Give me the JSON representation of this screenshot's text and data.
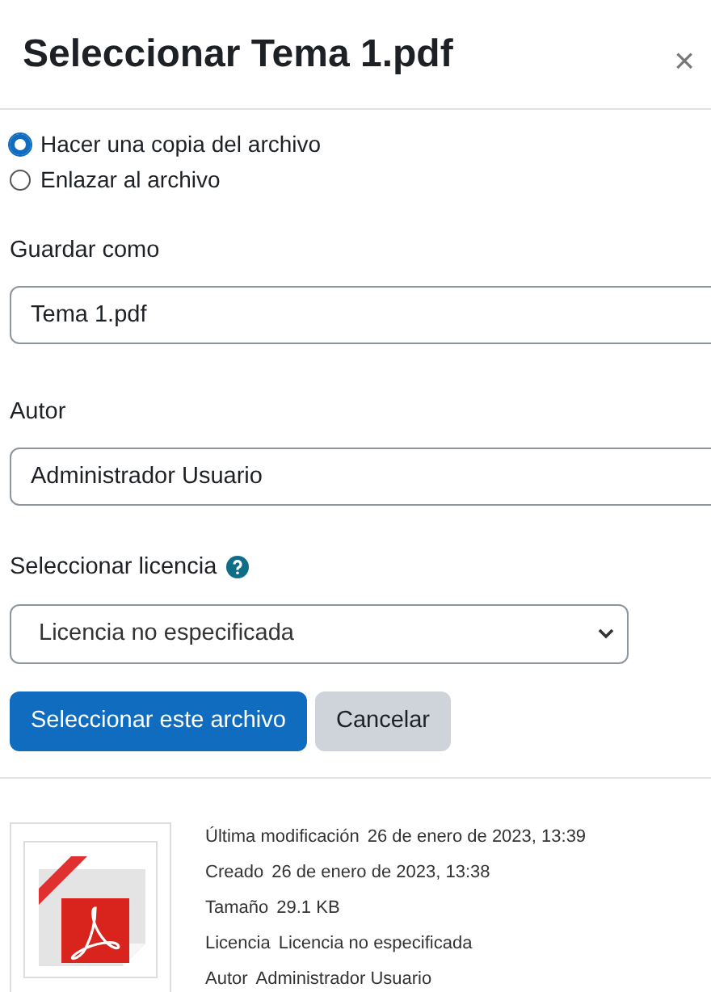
{
  "dialog": {
    "title": "Seleccionar Tema 1.pdf",
    "close": "×"
  },
  "options": [
    {
      "label": "Hacer una copia del archivo",
      "selected": true
    },
    {
      "label": "Enlazar al archivo",
      "selected": false
    }
  ],
  "save_as": {
    "label": "Guardar como",
    "value": "Tema 1.pdf"
  },
  "author": {
    "label": "Autor",
    "value": "Administrador Usuario"
  },
  "license": {
    "label": "Seleccionar licencia",
    "value": "Licencia no especificada"
  },
  "buttons": [
    {
      "label": "Seleccionar este archivo",
      "kind": "primary"
    },
    {
      "label": "Cancelar",
      "kind": "secondary"
    }
  ],
  "details": [
    {
      "label": "Última modificación",
      "value": "26 de enero de 2023, 13:39"
    },
    {
      "label": "Creado",
      "value": "26 de enero de 2023, 13:38"
    },
    {
      "label": "Tamaño",
      "value": "29.1 KB"
    },
    {
      "label": "Licencia",
      "value": "Licencia no especificada"
    },
    {
      "label": "Autor",
      "value": "Administrador Usuario"
    }
  ]
}
